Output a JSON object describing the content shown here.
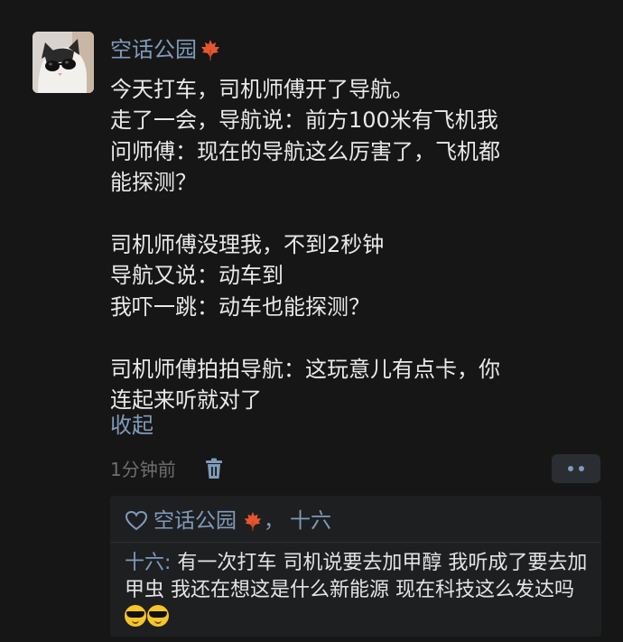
{
  "comment": {
    "username": "空话公园",
    "badge_icon": "maple-leaf-icon",
    "text_lines": [
      "今天打车，司机师傅开了导航。",
      "走了一会，导航说：前方100米有飞机我",
      "问师傅：现在的导航这么厉害了，飞机都",
      "能探测？",
      "",
      "司机师傅没理我，不到2秒钟",
      "导航又说：动车到",
      "我吓一跳：动车也能探测？",
      "",
      "司机师傅拍拍导航：这玩意儿有点卡，你",
      "连起来听就对了"
    ],
    "collapse_label": "收起",
    "time": "1分钟前",
    "delete_icon": "trash-icon",
    "more_icon": "more-dots-icon"
  },
  "reply_section": {
    "like_icon": "heart-icon",
    "liker_1": "空话公园",
    "liker_separator": "，",
    "liker_2": "十六",
    "reply": {
      "author": "十六",
      "separator": ": ",
      "text": "有一次打车 司机说要去加甲醇 我听成了要去加甲虫 我还在想这是什么新能源 现在科技这么发达吗",
      "emojis": [
        "sunglasses-emoji",
        "sunglasses-emoji"
      ]
    }
  },
  "colors": {
    "background": "#161616",
    "accent": "#7f9bbb",
    "text": "#e9e9e9",
    "muted": "#6e6e6e",
    "reply_bg": "#1e1f21"
  }
}
